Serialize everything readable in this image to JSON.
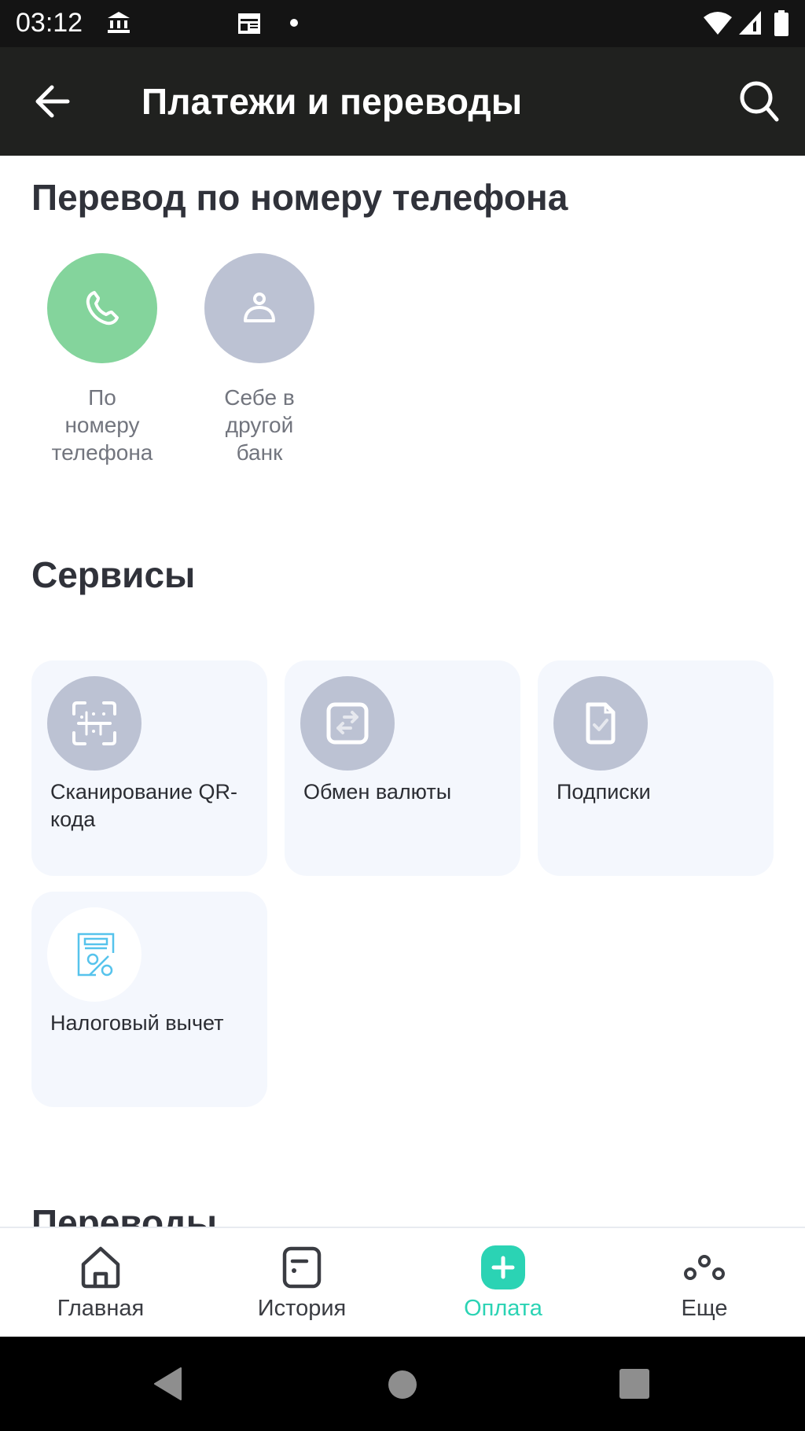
{
  "status_bar": {
    "time": "03:12",
    "icons": [
      "bank-icon",
      "calendar-icon",
      "dot-icon",
      "wifi-icon",
      "signal-icon",
      "battery-icon"
    ]
  },
  "app_bar": {
    "title": "Платежи и переводы",
    "back_icon": "arrow-left-icon",
    "search_icon": "search-icon"
  },
  "phone_transfer": {
    "title": "Перевод по номеру телефона",
    "items": [
      {
        "label": "По\nномеру\nтелефона",
        "lines": [
          "По",
          "номеру",
          "телефона"
        ],
        "icon": "phone-icon",
        "color": "#84d49c"
      },
      {
        "label": "Себе в\nдругой\nбанк",
        "lines": [
          "Себе в",
          "другой",
          "банк"
        ],
        "icon": "person-icon",
        "color": "#bcc2d3"
      }
    ]
  },
  "services": {
    "title": "Сервисы",
    "items": [
      {
        "label": "Сканирование QR-кода",
        "icon": "qr-scan-icon"
      },
      {
        "label": "Обмен валюты",
        "icon": "currency-exchange-icon"
      },
      {
        "label": "Подписки",
        "icon": "subscription-document-icon"
      },
      {
        "label": "Налоговый вычет",
        "icon": "tax-deduction-icon"
      }
    ]
  },
  "transfers": {
    "title": "Переводы"
  },
  "bottom_nav": {
    "items": [
      {
        "label": "Главная",
        "icon": "home-icon",
        "active": false
      },
      {
        "label": "История",
        "icon": "history-icon",
        "active": false
      },
      {
        "label": "Оплата",
        "icon": "plus-icon",
        "active": true
      },
      {
        "label": "Еще",
        "icon": "more-icon",
        "active": false
      }
    ],
    "active_color": "#2bd3b4"
  },
  "system_nav": {
    "buttons": [
      "back-triangle-icon",
      "home-circle-icon",
      "recents-square-icon"
    ]
  }
}
